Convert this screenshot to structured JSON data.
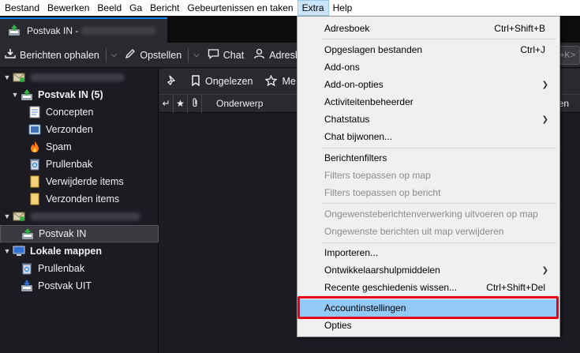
{
  "menubar": {
    "items": [
      "Bestand",
      "Bewerken",
      "Beeld",
      "Ga",
      "Bericht",
      "Gebeurtenissen en taken",
      "Extra",
      "Help"
    ],
    "active": "Extra"
  },
  "tab": {
    "title": "Postvak IN -"
  },
  "toolbar": {
    "get_messages": "Berichten ophalen",
    "compose": "Opstellen",
    "chat": "Chat",
    "address_book": "Adresb",
    "search_hint": "+K>"
  },
  "listbar": {
    "unread": "Ongelezen",
    "starred": "Me"
  },
  "columns": {
    "subject": "Onderwerp",
    "right_partial": "en"
  },
  "sidebar": {
    "account1": {
      "folders": [
        {
          "label": "Postvak IN (5)"
        },
        {
          "label": "Concepten"
        },
        {
          "label": "Verzonden"
        },
        {
          "label": "Spam"
        },
        {
          "label": "Prullenbak"
        },
        {
          "label": "Verwijderde items"
        },
        {
          "label": "Verzonden items"
        }
      ]
    },
    "account2": {
      "folders": [
        {
          "label": "Postvak IN"
        }
      ]
    },
    "local": {
      "label": "Lokale mappen",
      "folders": [
        {
          "label": "Prullenbak"
        },
        {
          "label": "Postvak UIT"
        }
      ]
    }
  },
  "extra_menu": {
    "items": [
      {
        "label": "Adresboek",
        "shortcut": "Ctrl+Shift+B"
      },
      {
        "label": "Opgeslagen bestanden",
        "shortcut": "Ctrl+J"
      },
      {
        "label": "Add-ons",
        "shortcut": ""
      },
      {
        "label": "Add-on-opties",
        "shortcut": ""
      },
      {
        "label": "Activiteitenbeheerder",
        "shortcut": ""
      },
      {
        "label": "Chatstatus",
        "shortcut": ""
      },
      {
        "label": "Chat bijwonen...",
        "shortcut": ""
      },
      {
        "label": "Berichtenfilters",
        "shortcut": ""
      },
      {
        "label": "Filters toepassen op map",
        "shortcut": ""
      },
      {
        "label": "Filters toepassen op bericht",
        "shortcut": ""
      },
      {
        "label": "Ongewensteberichtenverwerking uitvoeren op map",
        "shortcut": ""
      },
      {
        "label": "Ongewenste berichten uit map verwijderen",
        "shortcut": ""
      },
      {
        "label": "Importeren...",
        "shortcut": ""
      },
      {
        "label": "Ontwikkelaarshulpmiddelen",
        "shortcut": ""
      },
      {
        "label": "Recente geschiedenis wissen...",
        "shortcut": "Ctrl+Shift+Del"
      },
      {
        "label": "Accountinstellingen",
        "shortcut": ""
      },
      {
        "label": "Opties",
        "shortcut": ""
      }
    ]
  },
  "colors": {
    "accent": "#0a84ff",
    "menu_highlight": "#91c9f7",
    "annotation_box": "#e8001a"
  }
}
